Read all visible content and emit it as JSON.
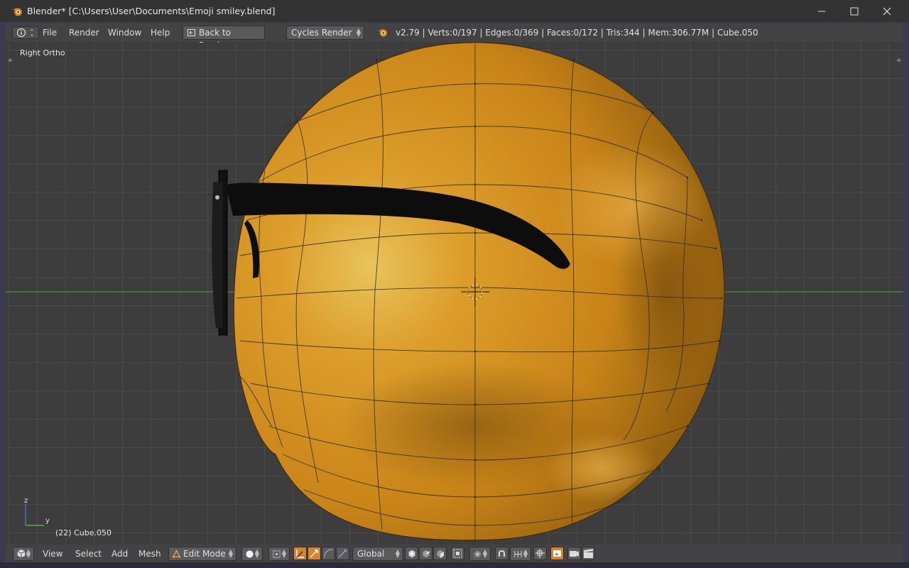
{
  "window": {
    "title": "Blender* [C:\\Users\\User\\Documents\\Emoji smiley.blend]"
  },
  "menu": {
    "file": "File",
    "render": "Render",
    "window": "Window",
    "help": "Help",
    "back_to_previous": "Back to Previous",
    "render_engine": "Cycles Render",
    "stats": "v2.79 | Verts:0/197 | Edges:0/369 | Faces:0/172 | Tris:344 | Mem:306.77M | Cube.050"
  },
  "viewport": {
    "view_label": "Right Ortho",
    "object_label": "(22) Cube.050",
    "axis_z": "z",
    "axis_y": "y"
  },
  "bottom": {
    "view": "View",
    "select": "Select",
    "add": "Add",
    "mesh": "Mesh",
    "mode": "Edit Mode",
    "orientation": "Global"
  },
  "colors": {
    "accent": "#d7822d",
    "ball": "#d98e1e",
    "viewport_bg": "#3d3d3d",
    "header_bg": "#434343"
  }
}
